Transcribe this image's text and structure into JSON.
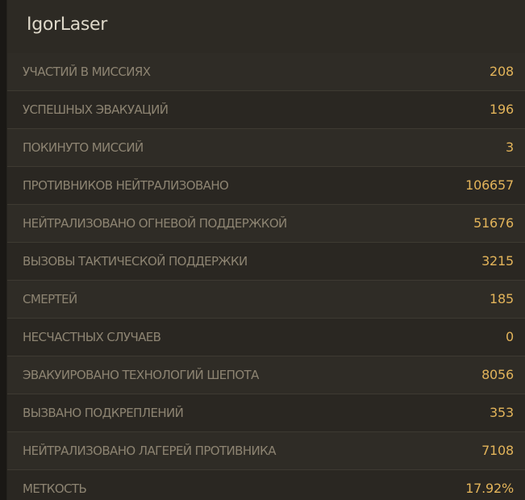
{
  "header": {
    "player_name": "IgorLaser"
  },
  "stats": [
    {
      "label": "УЧАСТИЙ В МИССИЯХ",
      "value": "208"
    },
    {
      "label": "УСПЕШНЫХ ЭВАКУАЦИЙ",
      "value": "196"
    },
    {
      "label": "ПОКИНУТО МИССИЙ",
      "value": "3"
    },
    {
      "label": "ПРОТИВНИКОВ НЕЙТРАЛИЗОВАНО",
      "value": "106657"
    },
    {
      "label": "НЕЙТРАЛИЗОВАНО ОГНЕВОЙ ПОДДЕРЖКОЙ",
      "value": "51676"
    },
    {
      "label": "ВЫЗОВЫ ТАКТИЧЕСКОЙ ПОДДЕРЖКИ",
      "value": "3215"
    },
    {
      "label": "СМЕРТЕЙ",
      "value": "185"
    },
    {
      "label": "НЕСЧАСТНЫХ СЛУЧАЕВ",
      "value": "0"
    },
    {
      "label": "ЭВАКУИРОВАНО ТЕХНОЛОГИЙ ШЕПОТА",
      "value": "8056"
    },
    {
      "label": "ВЫЗВАНО ПОДКРЕПЛЕНИЙ",
      "value": "353"
    },
    {
      "label": "НЕЙТРАЛИЗОВАНО ЛАГЕРЕЙ ПРОТИВНИКА",
      "value": "7108"
    },
    {
      "label": "МЕТКОСТЬ",
      "value": "17.92%"
    }
  ],
  "colors": {
    "background": "#2b2822",
    "label": "#8d8472",
    "value": "#e3b45a",
    "title": "#ded8c9"
  }
}
